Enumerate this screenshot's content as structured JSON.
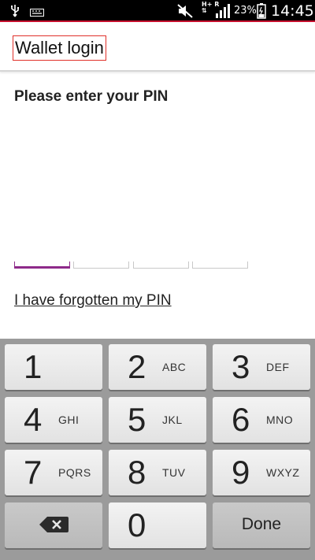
{
  "status_bar": {
    "icons": [
      "usb-icon",
      "keyboard-icon",
      "mute-icon",
      "network-hplus-icon",
      "signal-icon",
      "battery-icon"
    ],
    "network_top": "H+",
    "network_right": "R",
    "battery_percent": "23%",
    "time": "14:45"
  },
  "app_bar": {
    "title": "Wallet login"
  },
  "prompt": "Please enter your PIN",
  "pin": {
    "length": 4,
    "active_index": 0,
    "accent": "#8e2a8a"
  },
  "forgot_link": "I have forgotten my PIN",
  "keypad": {
    "keys": [
      {
        "digit": "1",
        "letters": ""
      },
      {
        "digit": "2",
        "letters": "ABC"
      },
      {
        "digit": "3",
        "letters": "DEF"
      },
      {
        "digit": "4",
        "letters": "GHI"
      },
      {
        "digit": "5",
        "letters": "JKL"
      },
      {
        "digit": "6",
        "letters": "MNO"
      },
      {
        "digit": "7",
        "letters": "PQRS"
      },
      {
        "digit": "8",
        "letters": "TUV"
      },
      {
        "digit": "9",
        "letters": "WXYZ"
      }
    ],
    "backspace_icon": "backspace-icon",
    "zero": "0",
    "done": "Done"
  },
  "colors": {
    "status_accent": "#c8102e",
    "title_highlight": "#e0302a",
    "keypad_bg": "#9b9b9b"
  }
}
